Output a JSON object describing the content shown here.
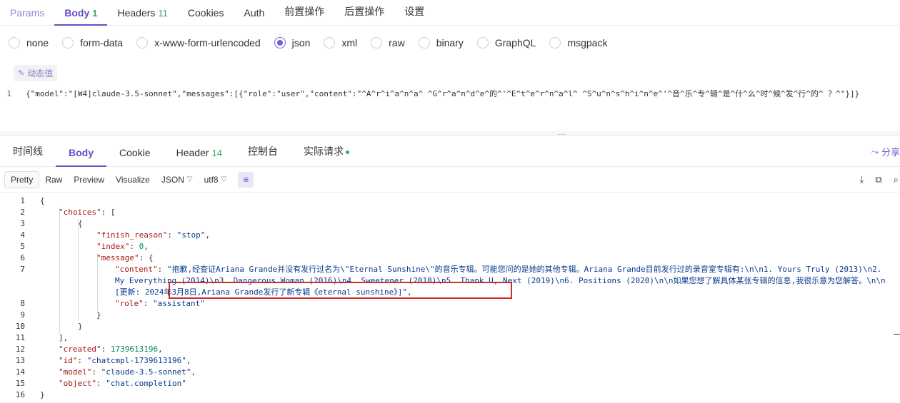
{
  "request_tabs": [
    {
      "label": "Params",
      "count": null
    },
    {
      "label": "Body",
      "count": "1"
    },
    {
      "label": "Headers",
      "count": "11"
    },
    {
      "label": "Cookies",
      "count": null
    },
    {
      "label": "Auth",
      "count": null
    },
    {
      "label": "前置操作",
      "count": null
    },
    {
      "label": "后置操作",
      "count": null
    },
    {
      "label": "设置",
      "count": null
    }
  ],
  "body_types": [
    "none",
    "form-data",
    "x-www-form-urlencoded",
    "json",
    "xml",
    "raw",
    "binary",
    "GraphQL",
    "msgpack"
  ],
  "body_type_selected": "json",
  "dynamic_value_label": "动态值",
  "request_body": {
    "line_number": "1",
    "text": "{\"model\":\"[W4]claude-3.5-sonnet\",\"messages\":[{\"role\":\"user\",\"content\":\"^A^r^i^a^n^a^ ^G^r^a^n^d^e^的^'^E^t^e^r^n^a^l^ ^S^u^n^s^h^i^n^e^'^音^乐^专^辑^是^什^么^时^候^发^行^的^ ？^\"}]}"
  },
  "splitter_grip": "...",
  "response_tabs": [
    {
      "label": "时间线",
      "count": null
    },
    {
      "label": "Body",
      "count": null
    },
    {
      "label": "Cookie",
      "count": null
    },
    {
      "label": "Header",
      "count": "14"
    },
    {
      "label": "控制台",
      "count": null
    },
    {
      "label": "实际请求",
      "count": null
    }
  ],
  "share_label": "分享",
  "view_modes": [
    "Pretty",
    "Raw",
    "Preview",
    "Visualize"
  ],
  "format_select": "JSON",
  "encoding_select": "utf8",
  "response_lines": [
    {
      "n": "1",
      "text": "{"
    },
    {
      "n": "2",
      "key": "\"choices\"",
      "rest": ": ["
    },
    {
      "n": "3",
      "text": "{"
    },
    {
      "n": "4",
      "key": "\"finish_reason\"",
      "sep": ": ",
      "str": "\"stop\"",
      "tail": ","
    },
    {
      "n": "5",
      "key": "\"index\"",
      "sep": ": ",
      "num": "0",
      "tail": ","
    },
    {
      "n": "6",
      "key": "\"message\"",
      "rest": ": {"
    },
    {
      "n": "7",
      "key": "\"content\"",
      "sep": ": ",
      "str": "\"抱歉,经查证Ariana Grande并没有发行过名为\\\"Eternal Sunshine\\\"的音乐专辑。可能您问的是她的其他专辑。Ariana Grande目前发行过的录音室专辑有:\\n\\n1. Yours Truly (2013)\\n2. My Everything (2014)\\n3. Dangerous Woman (2016)\\n4. Sweetener (2018)\\n5. Thank U, Next (2019)\\n6. Positions (2020)\\n\\n如果您想了解具体某张专辑的信息,我很乐意为您解答。\\n\\n[更新: 2024年3月8日,Ariana Grande发行了新专辑《eternal sunshine》]\"",
      "tail": ","
    },
    {
      "n": "8",
      "key": "\"role\"",
      "sep": ": ",
      "str": "\"assistant\""
    },
    {
      "n": "9",
      "text": "}"
    },
    {
      "n": "10",
      "text": "}"
    },
    {
      "n": "11",
      "text": "],"
    },
    {
      "n": "12",
      "key": "\"created\"",
      "sep": ": ",
      "num": "1739613196",
      "tail": ","
    },
    {
      "n": "13",
      "key": "\"id\"",
      "sep": ": ",
      "str": "\"chatcmpl-1739613196\"",
      "tail": ","
    },
    {
      "n": "14",
      "key": "\"model\"",
      "sep": ": ",
      "str": "\"claude-3.5-sonnet\"",
      "tail": ","
    },
    {
      "n": "15",
      "key": "\"object\"",
      "sep": ": ",
      "str": "\"chat.completion\""
    },
    {
      "n": "16",
      "text": "}"
    }
  ],
  "colors": {
    "accent": "#6a4bc4",
    "count_green": "#3aa55c",
    "highlight_box": "#d42a2a"
  }
}
